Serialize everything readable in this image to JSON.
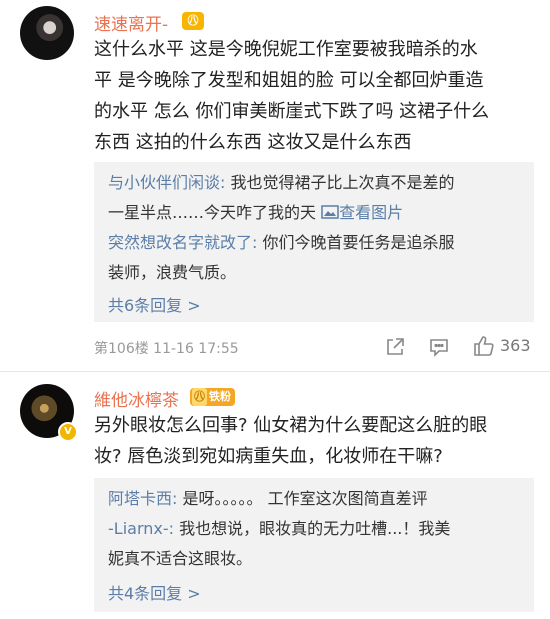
{
  "comments": [
    {
      "username": "速速离开-",
      "level_badge": "㊇",
      "text_lines": [
        "这什么水平 这是今晚倪妮工作室要被我暗杀的水",
        "平 是今晚除了发型和姐姐的脸 可以全都回炉重造",
        "的水平 怎么 你们审美断崖式下跌了吗 这裙子什么",
        "东西 这拍的什么东西 这妆又是什么东西"
      ],
      "replies": [
        {
          "author": "与小伙伴们闲谈:",
          "line1": " 我也觉得裙子比上次真不是差的",
          "line2": "一星半点……今天咋了我的天 ",
          "image_link": "查看图片"
        },
        {
          "author": "突然想改名字就改了:",
          "line1": " 你们今晚首要任务是追杀服",
          "line2": "装师，浪费气质。"
        }
      ],
      "more_replies": "共6条回复 >",
      "meta": "第106楼 11-16 17:55",
      "like_count": "363",
      "icons": [
        "share-icon",
        "comment-icon",
        "like-icon"
      ]
    },
    {
      "username": "維他冰檸茶",
      "fan_badge": {
        "level": "㊇",
        "label": "铁粉"
      },
      "verified": "V",
      "text_lines": [
        "另外眼妆怎么回事? 仙女裙为什么要配这么脏的眼",
        "妆? 唇色淡到宛如病重失血，化妆师在干嘛?"
      ],
      "replies": [
        {
          "author": "阿塔卡西:",
          "line1": " 是呀。。。。。 工作室这次图简直差评"
        },
        {
          "author": "-Liarnx-:",
          "line1": " 我也想说，眼妆真的无力吐槽...！我美",
          "line2": "妮真不适合这眼妆。"
        }
      ],
      "more_replies": "共4条回复 >"
    }
  ]
}
